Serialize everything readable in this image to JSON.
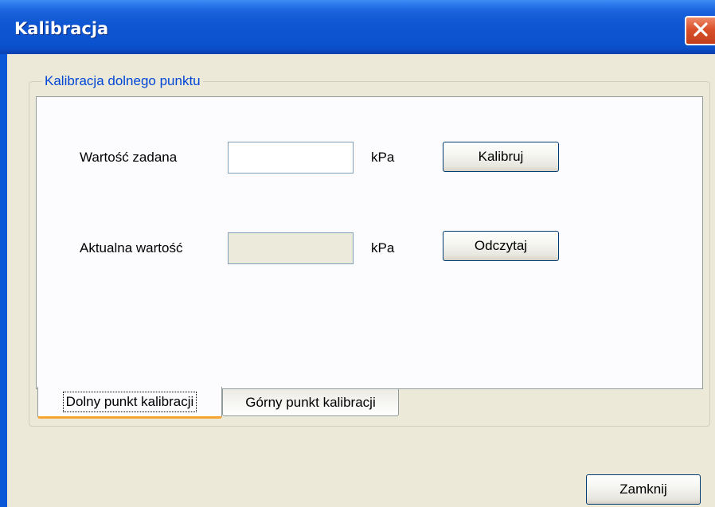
{
  "window": {
    "title": "Kalibracja"
  },
  "group": {
    "title": "Kalibracja dolnego punktu"
  },
  "form": {
    "setpoint_label": "Wartość zadana",
    "setpoint_value": "",
    "setpoint_unit": "kPa",
    "calibrate_label": "Kalibruj",
    "current_label": "Aktualna wartość",
    "current_value": "",
    "current_unit": "kPa",
    "read_label": "Odczytaj"
  },
  "tabs": [
    {
      "label": "Dolny punkt kalibracji",
      "active": true
    },
    {
      "label": "Górny punkt kalibracji",
      "active": false
    }
  ],
  "footer": {
    "close_label": "Zamknij"
  },
  "colors": {
    "titlebar": "#0a50cb",
    "group_title": "#0046d5",
    "close_button": "#d9502a",
    "active_tab_accent": "#f6a532"
  },
  "icons": {
    "close": "close-icon"
  }
}
